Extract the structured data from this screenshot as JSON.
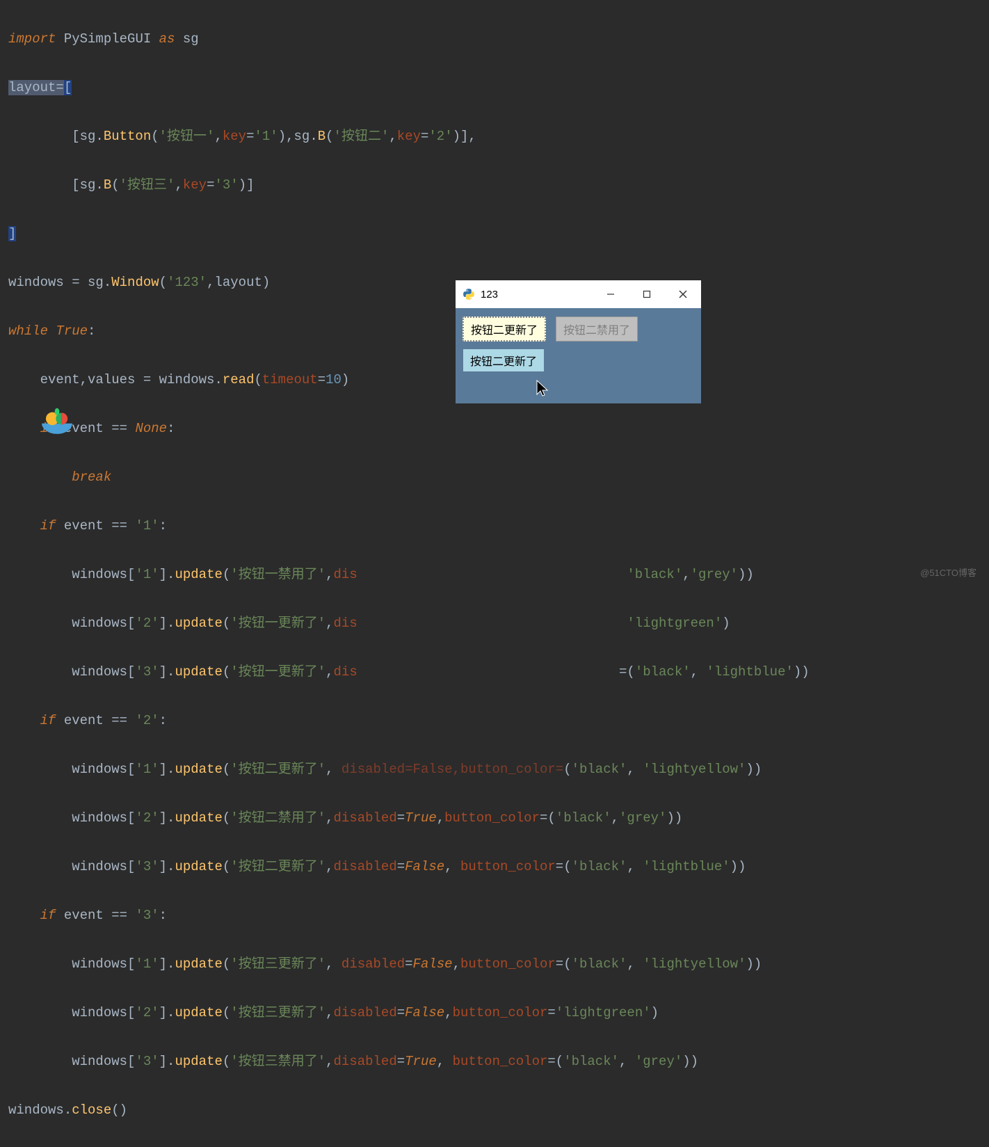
{
  "code": {
    "l1_import": "import",
    "l1_mod": "PySimpleGUI",
    "l1_as": "as",
    "l1_alias": "sg",
    "l2_layout": "layout",
    "l2_eq": "=",
    "l2_br": "[",
    "l3": "        [sg.",
    "l3_btn": "Button",
    "l3_p1": "(",
    "l3_s1": "'按钮一'",
    "l3_c": ",",
    "l3_key": "key",
    "l3_eq": "=",
    "l3_v1": "'1'",
    "l3_p2": "),sg.",
    "l3_B": "B",
    "l3_p3": "(",
    "l3_s2": "'按钮二'",
    "l3_c2": ",",
    "l3_key2": "key",
    "l3_eq2": "=",
    "l3_v2": "'2'",
    "l3_p4": ")],",
    "l4": "        [sg.",
    "l4_B": "B",
    "l4_p1": "(",
    "l4_s1": "'按钮三'",
    "l4_c": ",",
    "l4_key": "key",
    "l4_eq": "=",
    "l4_v1": "'3'",
    "l4_p2": ")]",
    "l5": "]",
    "l6_a": "windows = sg.",
    "l6_win": "Window",
    "l6_p": "(",
    "l6_s": "'123'",
    "l6_c": ",layout)",
    "l7_while": "while ",
    "l7_true": "True",
    "l7_col": ":",
    "l8_a": "    event,values = windows.",
    "l8_read": "read",
    "l8_p": "(",
    "l8_to": "timeout",
    "l8_eq": "=",
    "l8_v": "10",
    "l8_p2": ")",
    "l9_if": "    if ",
    "l9_ev": "event == ",
    "l9_none": "None",
    "l9_col": ":",
    "l10_brk": "        break",
    "l11_if": "    if ",
    "l11_ev": "event == ",
    "l11_v": "'1'",
    "l11_col": ":",
    "l12_a": "        windows[",
    "l12_k": "'1'",
    "l12_b": "].",
    "l12_up": "update",
    "l12_p": "(",
    "l12_s": "'按钮一禁用了'",
    "l12_c": ",",
    "l12_dis": "dis",
    "l12_tail": "'black'",
    "l12_c2": ",",
    "l12_tail2": "'grey'",
    "l12_p2": "))",
    "l13_a": "        windows[",
    "l13_k": "'2'",
    "l13_b": "].",
    "l13_up": "update",
    "l13_p": "(",
    "l13_s": "'按钮一更新了'",
    "l13_c": ",",
    "l13_dis": "dis",
    "l13_tail": "'lightgreen'",
    "l13_p2": ")",
    "l14_a": "        windows[",
    "l14_k": "'3'",
    "l14_b": "].",
    "l14_up": "update",
    "l14_p": "(",
    "l14_s": "'按钮一更新了'",
    "l14_c": ",",
    "l14_dis": "dis",
    "l14_eq": "=(",
    "l14_s1": "'black'",
    "l14_c2": ", ",
    "l14_s2": "'lightblue'",
    "l14_p2": "))",
    "l15_if": "    if ",
    "l15_ev": "event == ",
    "l15_v": "'2'",
    "l15_col": ":",
    "l16_a": "        windows[",
    "l16_k": "'1'",
    "l16_b": "].",
    "l16_up": "update",
    "l16_p": "(",
    "l16_s": "'按钮二更新了'",
    "l16_c": ", ",
    "l16_hidden": "disabled=False,button_color=",
    "l16_pp": "(",
    "l16_s1": "'black'",
    "l16_c2": ", ",
    "l16_s2": "'lightyellow'",
    "l16_p2": "))",
    "l17_a": "        windows[",
    "l17_k": "'2'",
    "l17_b": "].",
    "l17_up": "update",
    "l17_p": "(",
    "l17_s": "'按钮二禁用了'",
    "l17_c": ",",
    "l17_dis": "disabled",
    "l17_eq": "=",
    "l17_t": "True",
    "l17_c2": ",",
    "l17_bc": "button_color",
    "l17_eq2": "=(",
    "l17_s1": "'black'",
    "l17_c3": ",",
    "l17_s2": "'grey'",
    "l17_p2": "))",
    "l18_a": "        windows[",
    "l18_k": "'3'",
    "l18_b": "].",
    "l18_up": "update",
    "l18_p": "(",
    "l18_s": "'按钮二更新了'",
    "l18_c": ",",
    "l18_dis": "disabled",
    "l18_eq": "=",
    "l18_f": "False",
    "l18_c2": ", ",
    "l18_bc": "button_color",
    "l18_eq2": "=(",
    "l18_s1": "'black'",
    "l18_c3": ", ",
    "l18_s2": "'lightblue'",
    "l18_p2": "))",
    "l19_if": "    if ",
    "l19_ev": "event == ",
    "l19_v": "'3'",
    "l19_col": ":",
    "l20_a": "        windows[",
    "l20_k": "'1'",
    "l20_b": "].",
    "l20_up": "update",
    "l20_p": "(",
    "l20_s": "'按钮三更新了'",
    "l20_c": ", ",
    "l20_dis": "disabled",
    "l20_eq": "=",
    "l20_f": "False",
    "l20_c2": ",",
    "l20_bc": "button_color",
    "l20_eq2": "=(",
    "l20_s1": "'black'",
    "l20_c3": ", ",
    "l20_s2": "'lightyellow'",
    "l20_p2": "))",
    "l21_a": "        windows[",
    "l21_k": "'2'",
    "l21_b": "].",
    "l21_up": "update",
    "l21_p": "(",
    "l21_s": "'按钮三更新了'",
    "l21_c": ",",
    "l21_dis": "disabled",
    "l21_eq": "=",
    "l21_f": "False",
    "l21_c2": ",",
    "l21_bc": "button_color",
    "l21_eq2": "=",
    "l21_s1": "'lightgreen'",
    "l21_p2": ")",
    "l22_a": "        windows[",
    "l22_k": "'3'",
    "l22_b": "].",
    "l22_up": "update",
    "l22_p": "(",
    "l22_s": "'按钮三禁用了'",
    "l22_c": ",",
    "l22_dis": "disabled",
    "l22_eq": "=",
    "l22_t": "True",
    "l22_c2": ", ",
    "l22_bc": "button_color",
    "l22_eq2": "=(",
    "l22_s1": "'black'",
    "l22_c3": ", ",
    "l22_s2": "'grey'",
    "l22_p2": "))",
    "l23": "windows.",
    "l23_close": "close",
    "l23_p": "()"
  },
  "popup": {
    "title": "123",
    "btn1": "按钮二更新了",
    "btn2": "按钮二禁用了",
    "btn3": "按钮二更新了"
  },
  "watermark": "@51CTO博客"
}
